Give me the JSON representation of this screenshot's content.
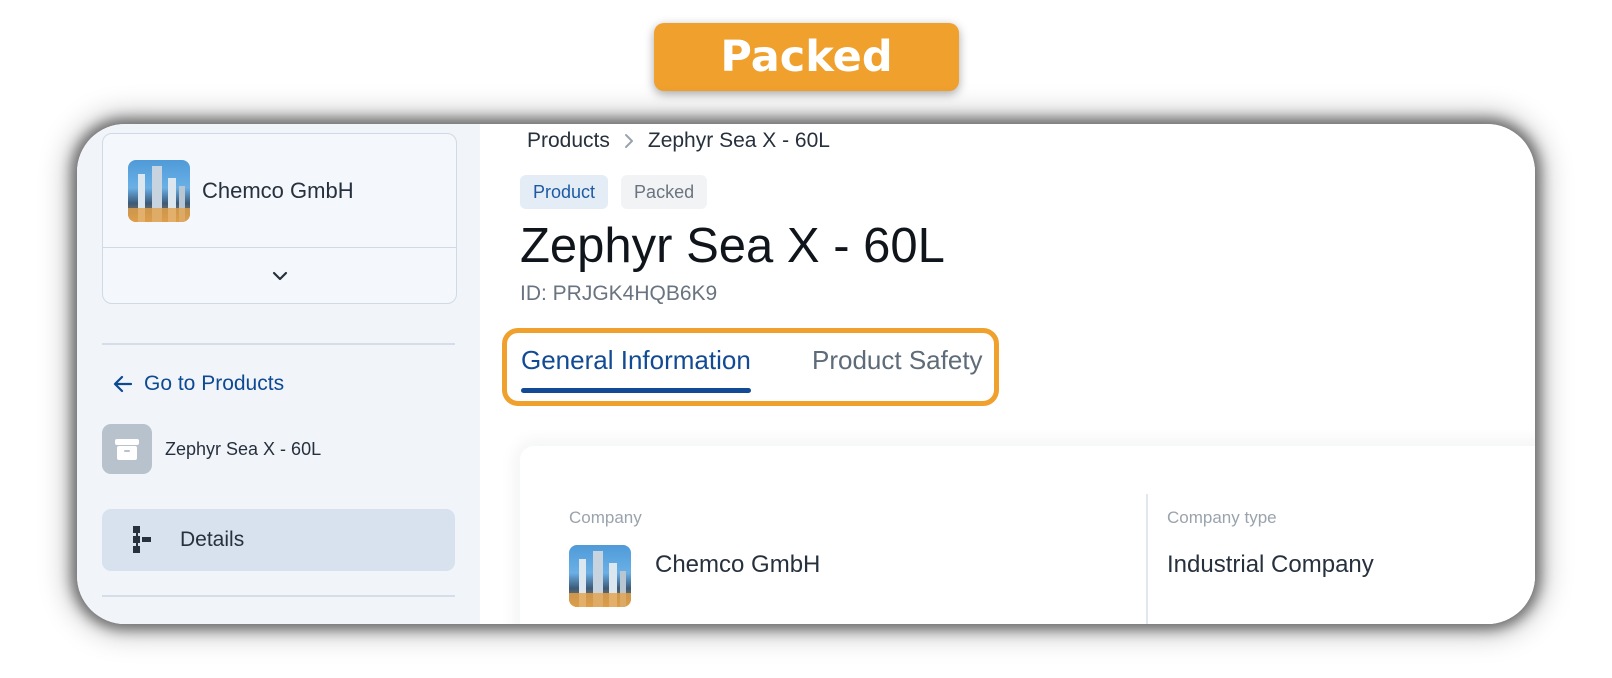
{
  "banner": {
    "label": "Packed"
  },
  "sidebar": {
    "company": {
      "name": "Chemco GmbH"
    },
    "back_link": "Go to Products",
    "product_item": "Zephyr Sea X - 60L",
    "nav": [
      {
        "label": "Details",
        "icon": "tree-structure-icon"
      }
    ]
  },
  "main": {
    "breadcrumb": [
      "Products",
      "Zephyr Sea X - 60L"
    ],
    "badges": [
      "Product",
      "Packed"
    ],
    "title": "Zephyr Sea X - 60L",
    "id_text": "ID: PRJGK4HQB6K9",
    "tabs": [
      {
        "label": "General Information",
        "active": true
      },
      {
        "label": "Product Safety",
        "active": false
      }
    ],
    "fields": {
      "company_label": "Company",
      "company_value": "Chemco GmbH",
      "company_type_label": "Company type",
      "company_type_value": "Industrial Company"
    }
  },
  "colors": {
    "highlight": "#f0a02c",
    "accent": "#124a93",
    "sidebar_bg": "#f1f5f9",
    "selected_nav_bg": "#d7e2ee"
  }
}
